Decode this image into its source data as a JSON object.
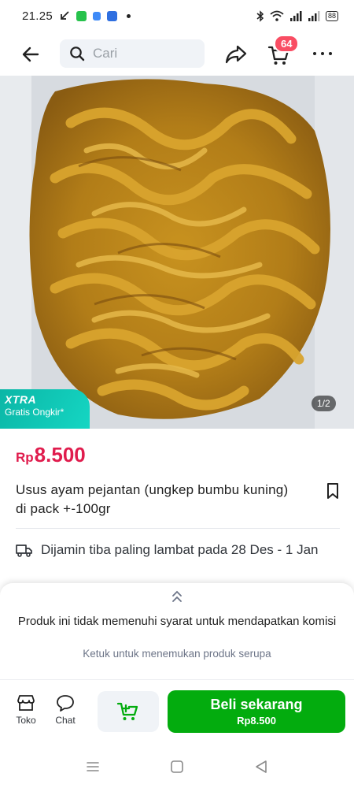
{
  "status_bar": {
    "time": "21.25",
    "battery": "88"
  },
  "header": {
    "search_placeholder": "Cari",
    "cart_count": "64"
  },
  "product": {
    "image_counter": "1/2",
    "promo_title": "XTRA",
    "promo_subtitle": "Gratis Ongkir*",
    "price_currency": "Rp",
    "price_value": "8.500",
    "title": "Usus ayam pejantan (ungkep bumbu kuning) di pack +-100gr",
    "shipping_text": "Dijamin tiba paling lambat pada 28 Des - 1 Jan"
  },
  "commission": {
    "message": "Produk ini tidak memenuhi syarat untuk mendapatkan komisi",
    "link": "Ketuk untuk menemukan produk serupa"
  },
  "action_bar": {
    "shop_label": "Toko",
    "chat_label": "Chat",
    "buy_label": "Beli sekarang",
    "buy_price": "Rp8.500"
  },
  "colors": {
    "price": "#e01c4d",
    "buy_button": "#03ac0e",
    "badge": "#f94d63",
    "xtra": "#0bb6a6"
  }
}
